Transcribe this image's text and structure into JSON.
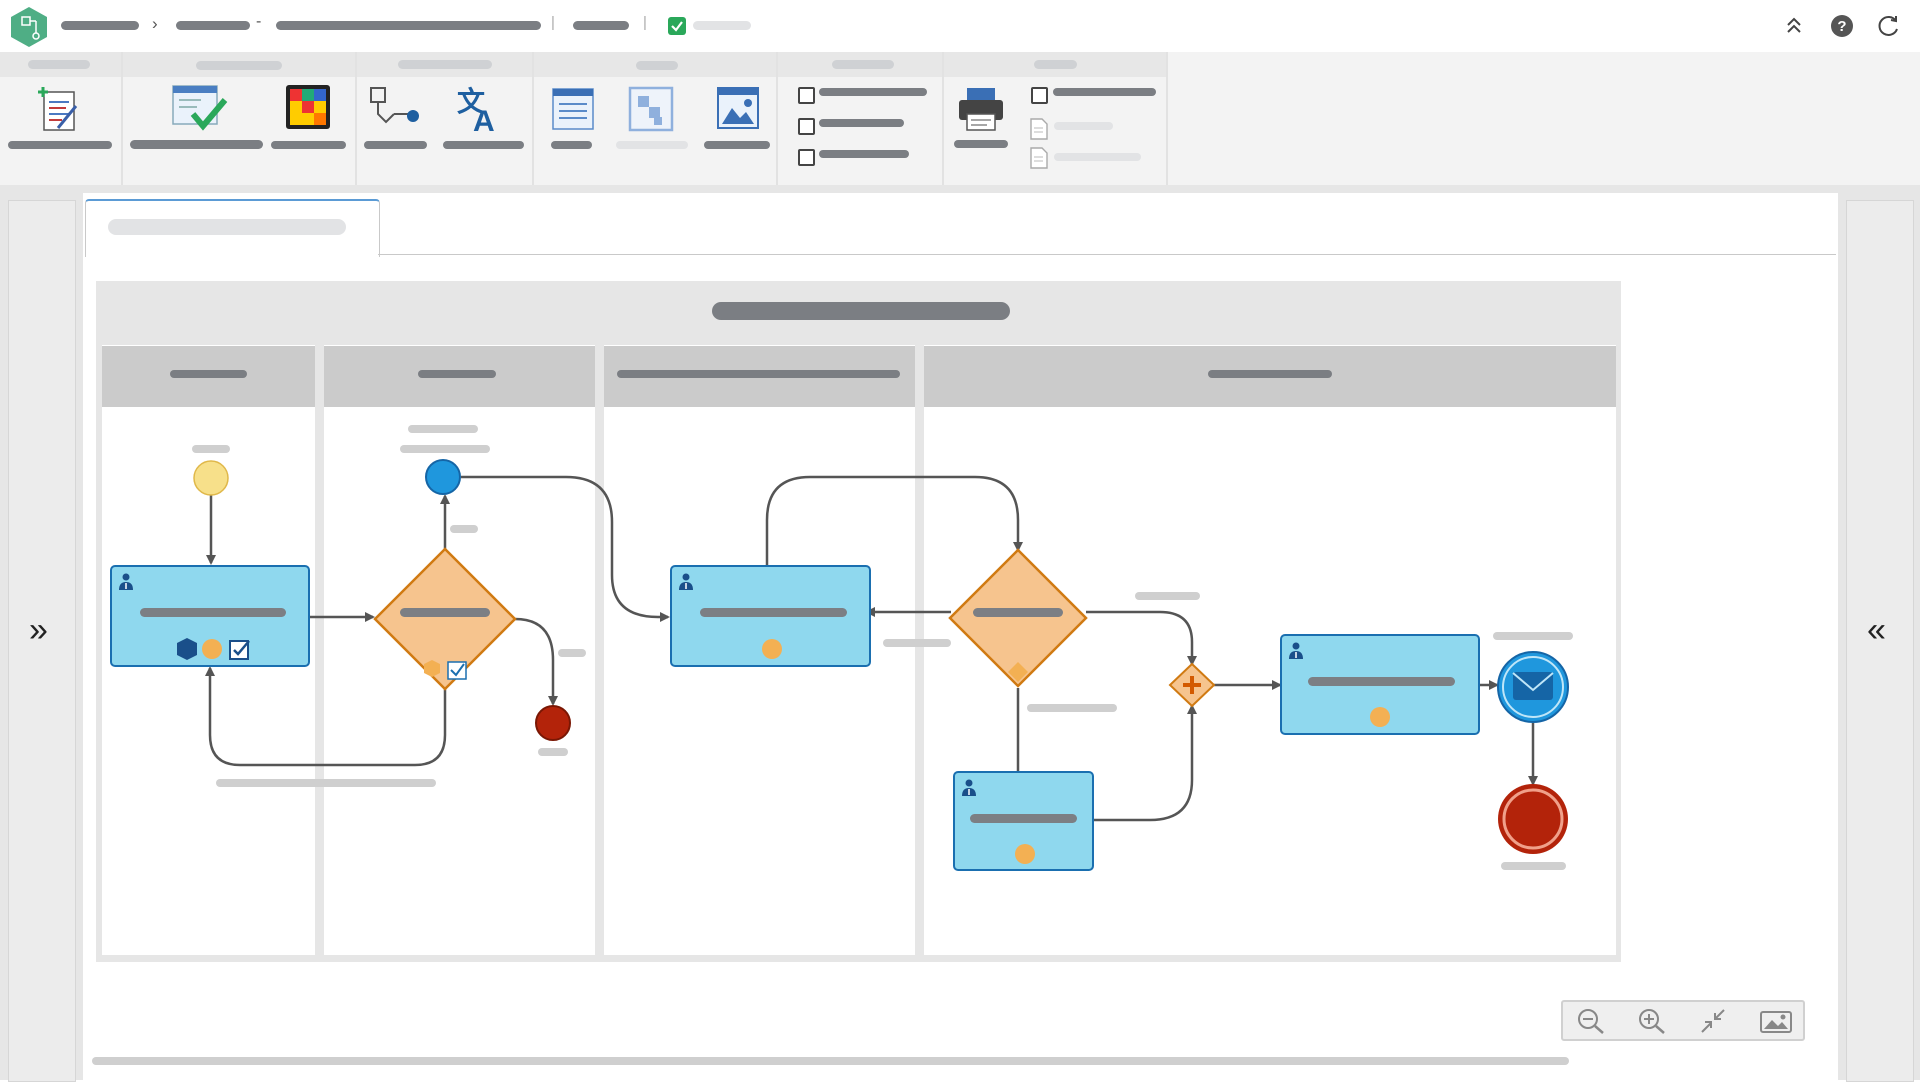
{
  "app": {
    "logo_icon": "app-logo-hexagon-icon",
    "brand_color": "#4fae85"
  },
  "breadcrumb": {
    "separator": "›",
    "dash": "-",
    "divider": "|"
  },
  "topbar_icons": [
    "collapse-ribbon-icon",
    "help-icon",
    "refresh-icon"
  ],
  "ribbon_checkboxes": [
    false,
    false,
    false,
    false
  ],
  "sidebars": {
    "left_toggle": "»",
    "right_toggle": "«"
  },
  "diagram": {
    "colors": {
      "task_fill": "#8fd8ee",
      "task_border": "#1a6fb0",
      "gateway_fill": "#f6c48e",
      "gateway_border": "#d07a12",
      "start_event": "#f7e08a",
      "end_event": "#b3230a",
      "resource": "#f3b053"
    }
  },
  "zoom_controls": [
    "zoom-out-icon",
    "zoom-in-icon",
    "fit-to-screen-icon",
    "export-image-icon"
  ]
}
